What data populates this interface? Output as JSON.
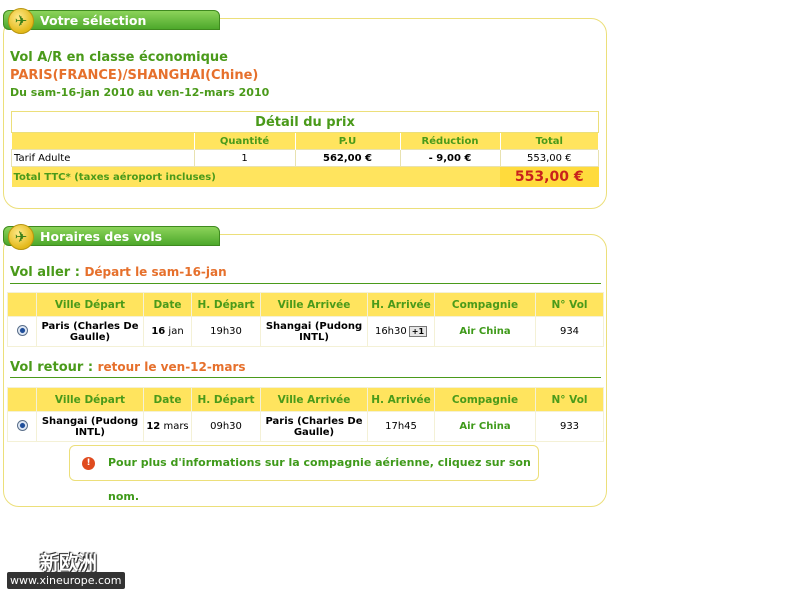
{
  "selection": {
    "tab_label": "Votre sélection",
    "title": "Vol A/R en classe économique",
    "route": "PARIS(FRANCE)/SHANGHAI(Chine)",
    "dates": "Du sam-16-jan 2010 au ven-12-mars 2010"
  },
  "price": {
    "title": "Détail du prix",
    "columns": [
      "",
      "Quantité",
      "P.U",
      "Réduction",
      "Total"
    ],
    "row": {
      "label": "Tarif Adulte",
      "qty": "1",
      "pu": "562,00 €",
      "reduction": "- 9,00 €",
      "total": "553,00 €"
    },
    "total_label": "Total TTC* (taxes aéroport incluses)",
    "total_value": "553,00 €"
  },
  "schedule": {
    "tab_label": "Horaires des vols",
    "columns": [
      "Ville Départ",
      "Date",
      "H. Départ",
      "Ville Arrivée",
      "H. Arrivée",
      "Compagnie",
      "N° Vol"
    ],
    "outbound": {
      "heading": "Vol aller",
      "sub": "Départ le sam-16-jan",
      "flight": {
        "from": "Paris (Charles De Gaulle)",
        "date_day": "16",
        "date_month": "jan",
        "dep": "19h30",
        "to": "Shangai (Pudong INTL)",
        "arr": "16h30",
        "plus_day": "+1",
        "airline": "Air China",
        "number": "934"
      }
    },
    "return": {
      "heading": "Vol retour",
      "sub": "retour le ven-12-mars",
      "flight": {
        "from": "Shangai (Pudong INTL)",
        "date_day": "12",
        "date_month": "mars",
        "dep": "09h30",
        "to": "Paris (Charles De Gaulle)",
        "arr": "17h45",
        "airline": "Air China",
        "number": "933"
      }
    },
    "info": "Pour plus d'informations sur la compagnie aérienne, cliquez sur son nom."
  },
  "watermark": {
    "cn": "新欧洲",
    "url": "www.xineurope.com"
  },
  "colors": {
    "green": "#4a9a1a",
    "orange": "#e6702c",
    "yellow": "#ffe45e",
    "red": "#c9221c"
  },
  "icons": {
    "tab": "airplane-icon",
    "info": "info-icon"
  }
}
